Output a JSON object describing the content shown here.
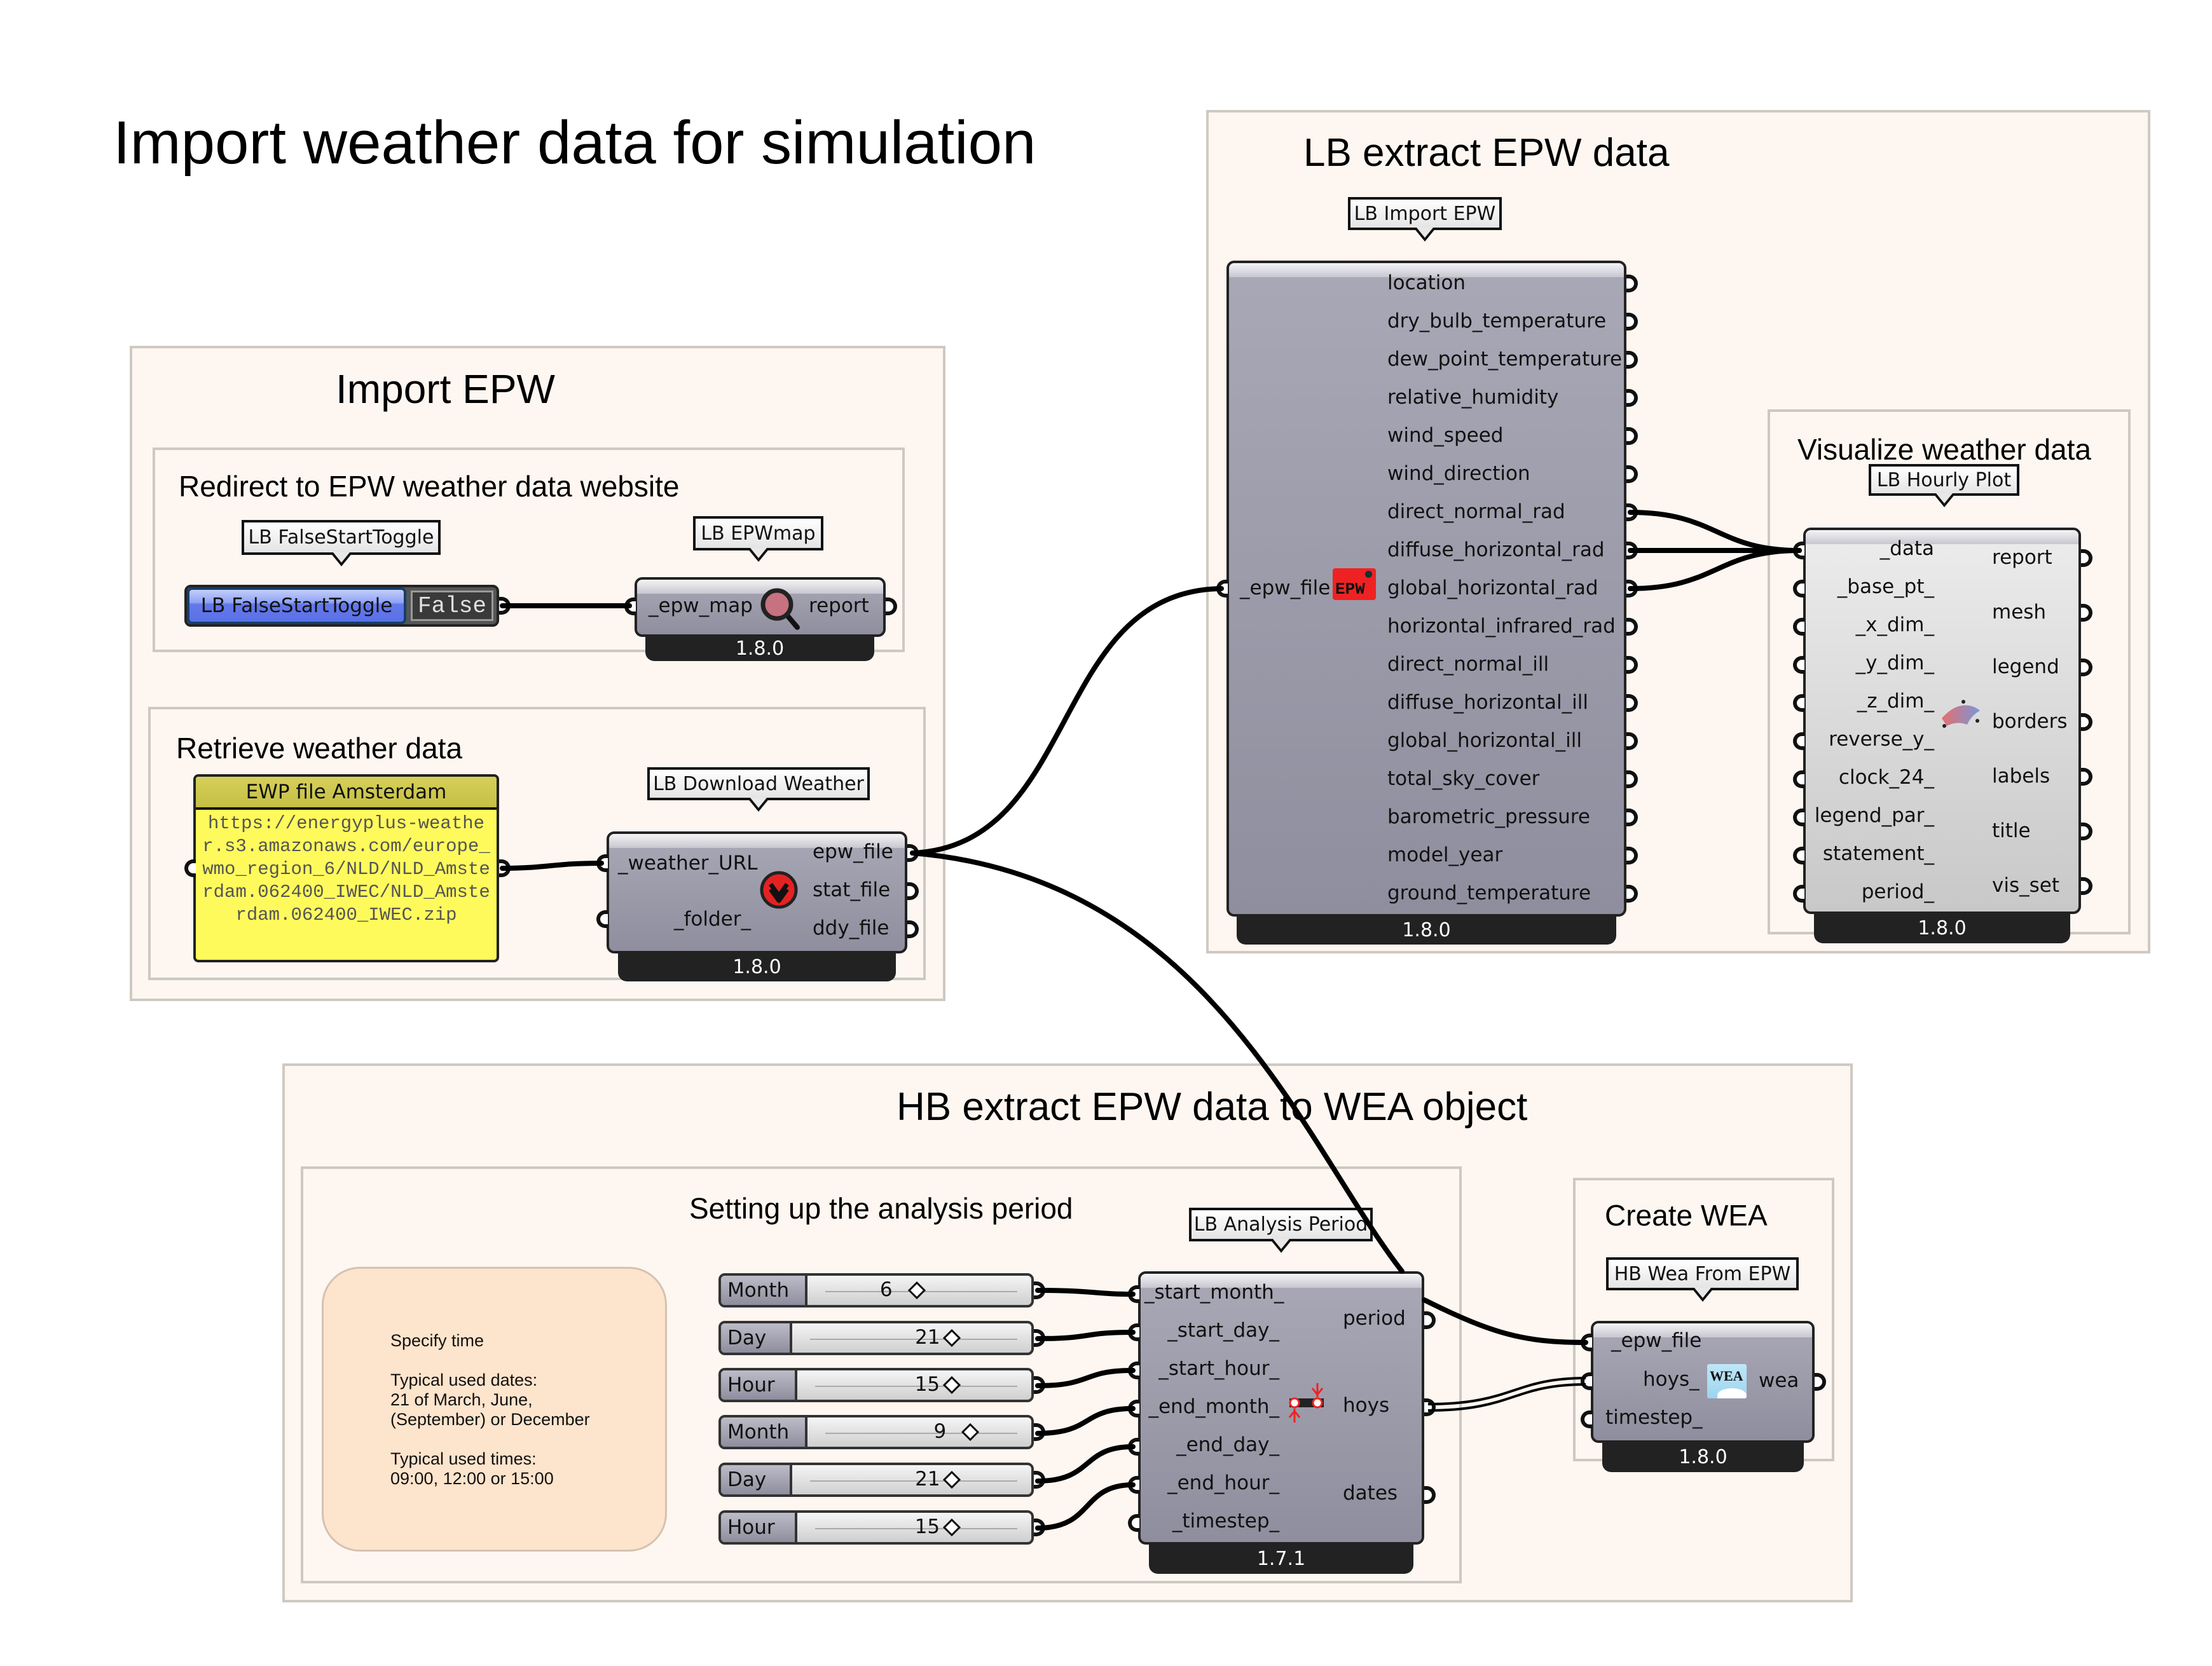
{
  "title": "Import weather data for simulation",
  "groups": {
    "import_epw": {
      "title": "Import EPW",
      "redirect": {
        "title": "Redirect to EPW weather data website",
        "toggle": {
          "tooltip": "LB FalseStartToggle",
          "name": "LB FalseStartToggle",
          "value": "False"
        },
        "epwmap": {
          "tooltip": "LB EPWmap",
          "input": "_epw_map",
          "output": "report",
          "version": "1.8.0",
          "icon": "magnifier-icon"
        }
      },
      "retrieve": {
        "title": "Retrieve weather data",
        "panel": {
          "title": "EWP file Amsterdam",
          "content": "https://energyplus-weather.s3.amazonaws.com/europe_wmo_region_6/NLD/NLD_Amsterdam.062400_IWEC/NLD_Amsterdam.062400_IWEC.zip"
        },
        "download": {
          "tooltip": "LB Download Weather",
          "inputs": [
            "_weather_URL",
            "_folder_"
          ],
          "outputs": [
            "epw_file",
            "stat_file",
            "ddy_file"
          ],
          "version": "1.8.0",
          "icon": "download-icon"
        }
      }
    },
    "lb_extract": {
      "title": "LB extract EPW data",
      "import_epw": {
        "tooltip": "LB Import EPW",
        "input": "_epw_file",
        "icon": "epw-icon",
        "icon_text": "EPW",
        "outputs": [
          "location",
          "dry_bulb_temperature",
          "dew_point_temperature",
          "relative_humidity",
          "wind_speed",
          "wind_direction",
          "direct_normal_rad",
          "diffuse_horizontal_rad",
          "global_horizontal_rad",
          "horizontal_infrared_rad",
          "direct_normal_ill",
          "diffuse_horizontal_ill",
          "global_horizontal_ill",
          "total_sky_cover",
          "barometric_pressure",
          "model_year",
          "ground_temperature"
        ],
        "version": "1.8.0"
      },
      "visualize": {
        "title": "Visualize weather data",
        "hourly_plot": {
          "tooltip": "LB Hourly Plot",
          "inputs": [
            "_data",
            "_base_pt_",
            "_x_dim_",
            "_y_dim_",
            "_z_dim_",
            "reverse_y_",
            "clock_24_",
            "legend_par_",
            "statement_",
            "period_"
          ],
          "outputs": [
            "report",
            "mesh",
            "legend",
            "borders",
            "labels",
            "title",
            "vis_set"
          ],
          "version": "1.8.0",
          "icon": "hourly-plot-icon"
        }
      }
    },
    "hb_extract": {
      "title": "HB extract EPW data to WEA object",
      "analysis": {
        "title": "Setting up the analysis period",
        "note": "Specify time\n\nTypical used dates:\n21 of March, June,\n(September) or December\n\nTypical used times:\n09:00, 12:00 or 15:00",
        "sliders": [
          {
            "name": "Month",
            "value": "6",
            "fraction": 0.45
          },
          {
            "name": "Day",
            "value": "21",
            "fraction": 0.66
          },
          {
            "name": "Hour",
            "value": "15",
            "fraction": 0.65
          },
          {
            "name": "Month",
            "value": "9",
            "fraction": 0.73
          },
          {
            "name": "Day",
            "value": "21",
            "fraction": 0.66
          },
          {
            "name": "Hour",
            "value": "15",
            "fraction": 0.65
          }
        ],
        "period_comp": {
          "tooltip": "LB Analysis Period",
          "inputs": [
            "_start_month_",
            "_start_day_",
            "_start_hour_",
            "_end_month_",
            "_end_day_",
            "_end_hour_",
            "_timestep_"
          ],
          "outputs": [
            "period",
            "hoys",
            "dates"
          ],
          "version": "1.7.1",
          "icon": "analysis-period-icon"
        }
      },
      "create_wea": {
        "title": "Create WEA",
        "wea_comp": {
          "tooltip": "HB Wea From EPW",
          "inputs": [
            "_epw_file",
            "hoys_",
            "timestep_"
          ],
          "output": "wea",
          "version": "1.8.0",
          "icon": "wea-icon",
          "icon_text": "WEA"
        }
      }
    }
  },
  "colors": {
    "group_fill": "#fef7f1",
    "group_border": "#cfc9c3",
    "component_fill": "#a3a2b1",
    "footer": "#222222",
    "toggle_blue": "#5a70e6",
    "panel_yellow": "#fffa5c",
    "note_fill": "#fde4cc",
    "epw_icon_red": "#ee2222"
  }
}
